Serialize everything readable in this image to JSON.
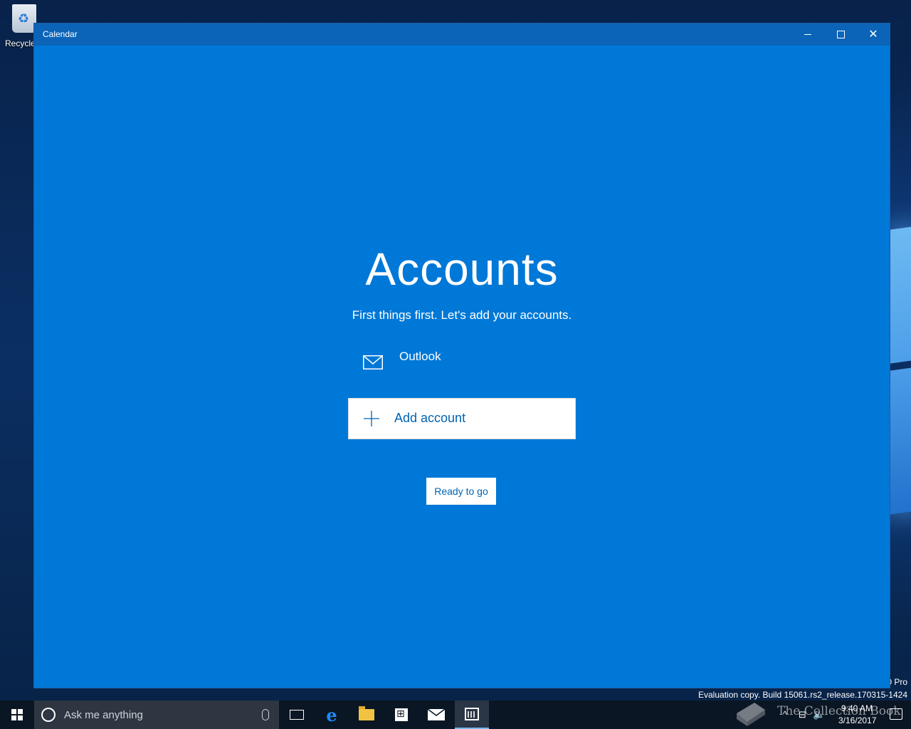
{
  "desktop": {
    "recycle_bin_label": "Recycle",
    "watermark_line1": "0 Pro",
    "watermark_line2": "Evaluation copy. Build 15061.rs2_release.170315-1424",
    "overlay_text": "The Collection Book"
  },
  "window": {
    "title": "Calendar",
    "controls": {
      "minimize": "minimize",
      "maximize": "maximize",
      "close": "✕"
    }
  },
  "accounts": {
    "heading": "Accounts",
    "subtitle": "First things first. Let's add your accounts.",
    "items": [
      {
        "name": "Outlook",
        "icon": "mail-icon"
      }
    ],
    "add_label": "Add account",
    "ready_label": "Ready to go"
  },
  "taskbar": {
    "search_placeholder": "Ask me anything",
    "apps": [
      "task-view",
      "edge",
      "file-explorer",
      "store",
      "mail",
      "calendar"
    ],
    "active_app": "calendar"
  },
  "tray": {
    "time": "9:40 AM",
    "date": "3/16/2017"
  },
  "colors": {
    "app_background": "#0078d7",
    "titlebar": "#0b64b8",
    "accent_text": "#0063b1",
    "taskbar": "#0b1624"
  }
}
